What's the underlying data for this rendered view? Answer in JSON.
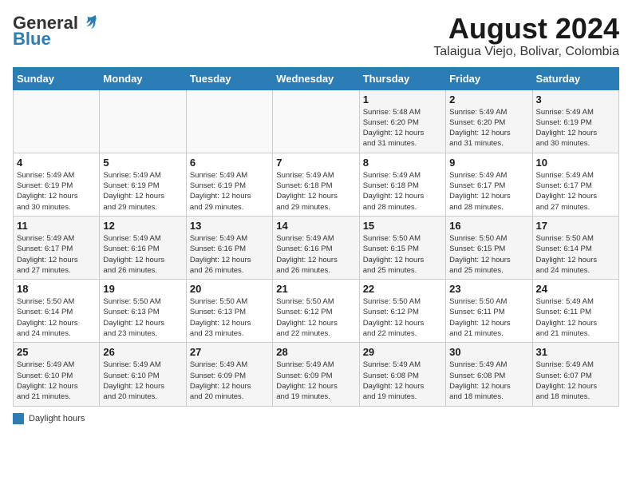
{
  "header": {
    "logo_general": "General",
    "logo_blue": "Blue",
    "month_title": "August 2024",
    "location": "Talaigua Viejo, Bolivar, Colombia"
  },
  "days_of_week": [
    "Sunday",
    "Monday",
    "Tuesday",
    "Wednesday",
    "Thursday",
    "Friday",
    "Saturday"
  ],
  "weeks": [
    [
      {
        "day": "",
        "info": ""
      },
      {
        "day": "",
        "info": ""
      },
      {
        "day": "",
        "info": ""
      },
      {
        "day": "",
        "info": ""
      },
      {
        "day": "1",
        "info": "Sunrise: 5:48 AM\nSunset: 6:20 PM\nDaylight: 12 hours\nand 31 minutes."
      },
      {
        "day": "2",
        "info": "Sunrise: 5:49 AM\nSunset: 6:20 PM\nDaylight: 12 hours\nand 31 minutes."
      },
      {
        "day": "3",
        "info": "Sunrise: 5:49 AM\nSunset: 6:19 PM\nDaylight: 12 hours\nand 30 minutes."
      }
    ],
    [
      {
        "day": "4",
        "info": "Sunrise: 5:49 AM\nSunset: 6:19 PM\nDaylight: 12 hours\nand 30 minutes."
      },
      {
        "day": "5",
        "info": "Sunrise: 5:49 AM\nSunset: 6:19 PM\nDaylight: 12 hours\nand 29 minutes."
      },
      {
        "day": "6",
        "info": "Sunrise: 5:49 AM\nSunset: 6:19 PM\nDaylight: 12 hours\nand 29 minutes."
      },
      {
        "day": "7",
        "info": "Sunrise: 5:49 AM\nSunset: 6:18 PM\nDaylight: 12 hours\nand 29 minutes."
      },
      {
        "day": "8",
        "info": "Sunrise: 5:49 AM\nSunset: 6:18 PM\nDaylight: 12 hours\nand 28 minutes."
      },
      {
        "day": "9",
        "info": "Sunrise: 5:49 AM\nSunset: 6:17 PM\nDaylight: 12 hours\nand 28 minutes."
      },
      {
        "day": "10",
        "info": "Sunrise: 5:49 AM\nSunset: 6:17 PM\nDaylight: 12 hours\nand 27 minutes."
      }
    ],
    [
      {
        "day": "11",
        "info": "Sunrise: 5:49 AM\nSunset: 6:17 PM\nDaylight: 12 hours\nand 27 minutes."
      },
      {
        "day": "12",
        "info": "Sunrise: 5:49 AM\nSunset: 6:16 PM\nDaylight: 12 hours\nand 26 minutes."
      },
      {
        "day": "13",
        "info": "Sunrise: 5:49 AM\nSunset: 6:16 PM\nDaylight: 12 hours\nand 26 minutes."
      },
      {
        "day": "14",
        "info": "Sunrise: 5:49 AM\nSunset: 6:16 PM\nDaylight: 12 hours\nand 26 minutes."
      },
      {
        "day": "15",
        "info": "Sunrise: 5:50 AM\nSunset: 6:15 PM\nDaylight: 12 hours\nand 25 minutes."
      },
      {
        "day": "16",
        "info": "Sunrise: 5:50 AM\nSunset: 6:15 PM\nDaylight: 12 hours\nand 25 minutes."
      },
      {
        "day": "17",
        "info": "Sunrise: 5:50 AM\nSunset: 6:14 PM\nDaylight: 12 hours\nand 24 minutes."
      }
    ],
    [
      {
        "day": "18",
        "info": "Sunrise: 5:50 AM\nSunset: 6:14 PM\nDaylight: 12 hours\nand 24 minutes."
      },
      {
        "day": "19",
        "info": "Sunrise: 5:50 AM\nSunset: 6:13 PM\nDaylight: 12 hours\nand 23 minutes."
      },
      {
        "day": "20",
        "info": "Sunrise: 5:50 AM\nSunset: 6:13 PM\nDaylight: 12 hours\nand 23 minutes."
      },
      {
        "day": "21",
        "info": "Sunrise: 5:50 AM\nSunset: 6:12 PM\nDaylight: 12 hours\nand 22 minutes."
      },
      {
        "day": "22",
        "info": "Sunrise: 5:50 AM\nSunset: 6:12 PM\nDaylight: 12 hours\nand 22 minutes."
      },
      {
        "day": "23",
        "info": "Sunrise: 5:50 AM\nSunset: 6:11 PM\nDaylight: 12 hours\nand 21 minutes."
      },
      {
        "day": "24",
        "info": "Sunrise: 5:49 AM\nSunset: 6:11 PM\nDaylight: 12 hours\nand 21 minutes."
      }
    ],
    [
      {
        "day": "25",
        "info": "Sunrise: 5:49 AM\nSunset: 6:10 PM\nDaylight: 12 hours\nand 21 minutes."
      },
      {
        "day": "26",
        "info": "Sunrise: 5:49 AM\nSunset: 6:10 PM\nDaylight: 12 hours\nand 20 minutes."
      },
      {
        "day": "27",
        "info": "Sunrise: 5:49 AM\nSunset: 6:09 PM\nDaylight: 12 hours\nand 20 minutes."
      },
      {
        "day": "28",
        "info": "Sunrise: 5:49 AM\nSunset: 6:09 PM\nDaylight: 12 hours\nand 19 minutes."
      },
      {
        "day": "29",
        "info": "Sunrise: 5:49 AM\nSunset: 6:08 PM\nDaylight: 12 hours\nand 19 minutes."
      },
      {
        "day": "30",
        "info": "Sunrise: 5:49 AM\nSunset: 6:08 PM\nDaylight: 12 hours\nand 18 minutes."
      },
      {
        "day": "31",
        "info": "Sunrise: 5:49 AM\nSunset: 6:07 PM\nDaylight: 12 hours\nand 18 minutes."
      }
    ]
  ],
  "legend": {
    "label": "Daylight hours"
  }
}
